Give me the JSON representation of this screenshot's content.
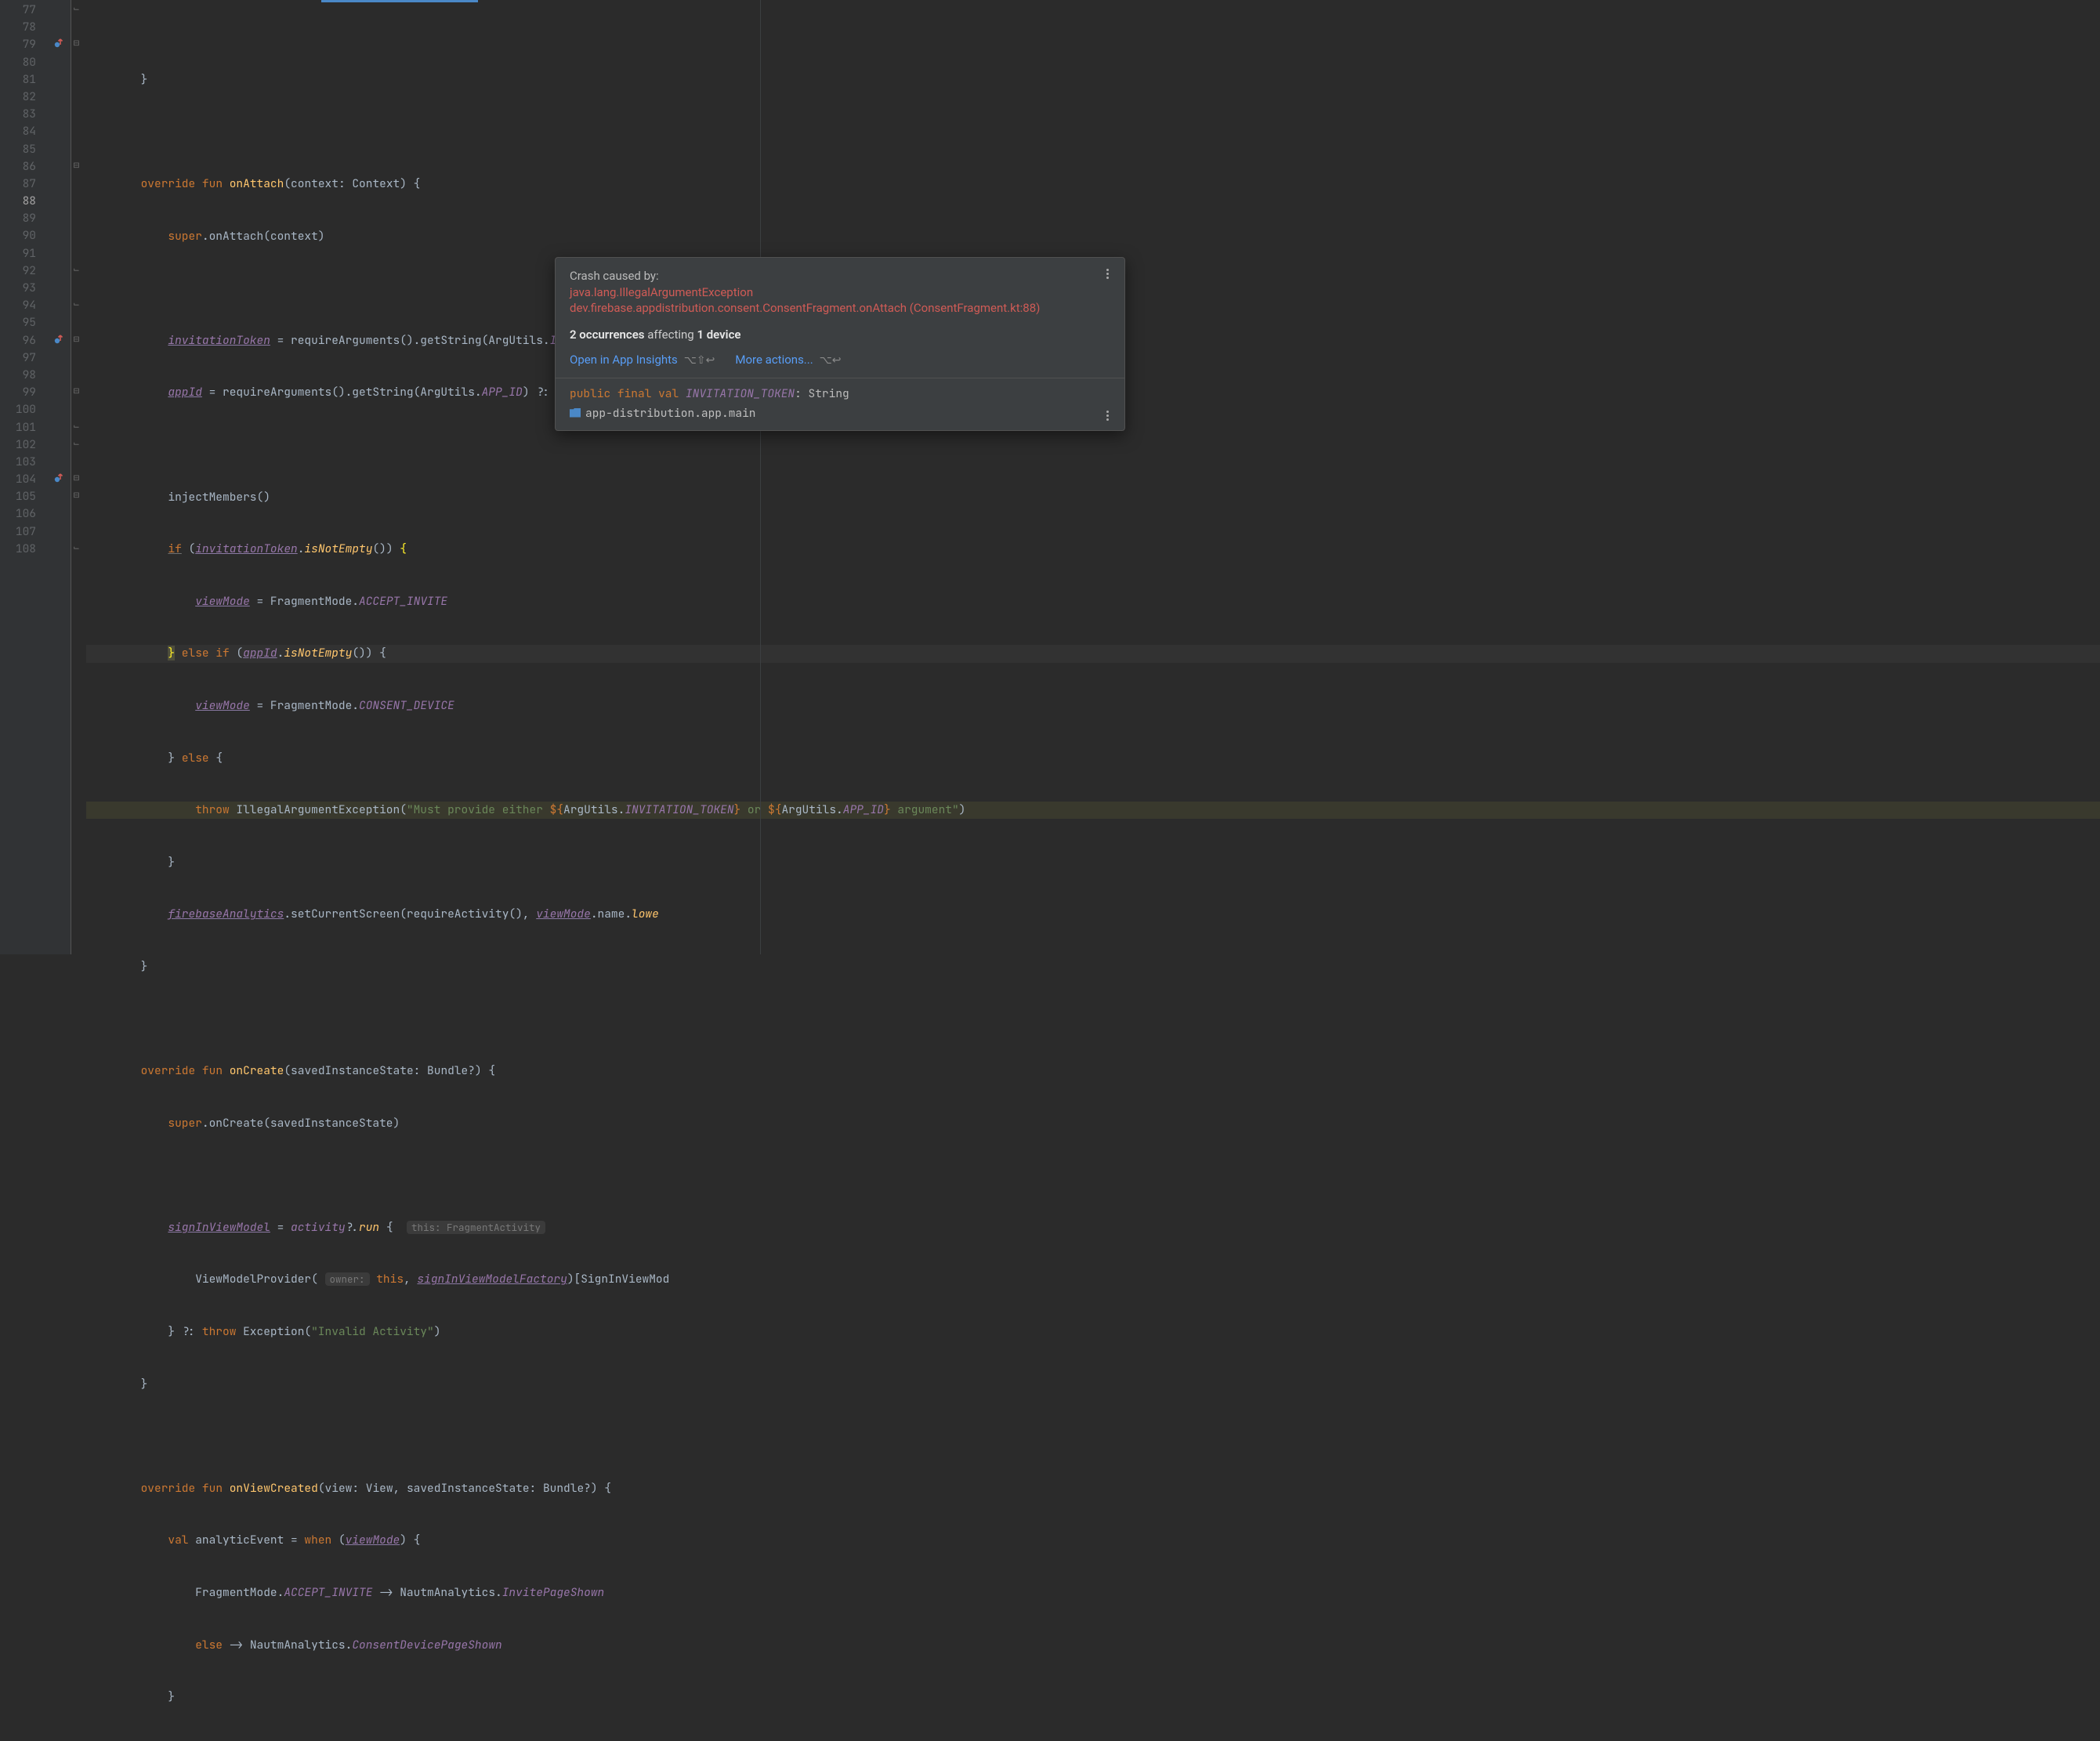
{
  "gutter": {
    "start": 77,
    "end": 108,
    "current": 88,
    "override_markers": [
      79,
      96,
      104
    ]
  },
  "fold_markers": {
    "minus_at": [
      79,
      86,
      96,
      99,
      104,
      105
    ],
    "end_at": [
      77,
      92,
      94,
      101,
      102,
      108
    ]
  },
  "code": {
    "l77": "        }",
    "l79_override": "override",
    "l79_fun": "fun",
    "l79_name": "onAttach",
    "l79_params": "(context: Context) {",
    "l80_super": "super",
    "l80_rest": ".onAttach(context)",
    "l82_field": "invitationToken",
    "l82_mid": " = requireArguments().getString(ArgUtils.",
    "l82_const": "INVITATION_TOKEN",
    "l82_tail": ") ?: ",
    "l82_str": "\"\"",
    "l83_field": "appId",
    "l83_mid": " = requireArguments().getString(ArgUtils.",
    "l83_const": "APP_ID",
    "l83_tail": ") ?: ",
    "l83_str": "\"\"",
    "l85": "            injectMembers()",
    "l86_if": "if",
    "l86_open": " (",
    "l86_tok": "invitationToken",
    "l86_dot": ".",
    "l86_fn": "isNotEmpty",
    "l86_close": "()) ",
    "l86_brace": "{",
    "l87_vm": "viewMode",
    "l87_eq": " = FragmentMode.",
    "l87_const": "ACCEPT_INVITE",
    "l88_close": "}",
    "l88_else": " else if ",
    "l88_open": "(",
    "l88_tok": "appId",
    "l88_dot": ".",
    "l88_fn": "isNotEmpty",
    "l88_cl2": "()) {",
    "l89_vm": "viewMode",
    "l89_eq": " = FragmentMode.",
    "l89_const": "CONSENT_DEVICE",
    "l90_close": "} ",
    "l90_else": "else",
    "l90_brace": " {",
    "l91_throw": "throw",
    "l91_cls": " IllegalArgumentException(",
    "l91_s1": "\"Must provide either ",
    "l91_d1": "${",
    "l91_a1": "ArgUtils.",
    "l91_c1": "INVITATION_TOKEN",
    "l91_d1e": "}",
    "l91_s2": " or ",
    "l91_d2": "${",
    "l91_a2": "ArgUtils.",
    "l91_c2": "APP_ID",
    "l91_d2e": "}",
    "l91_s3": " argument\"",
    "l91_end": ")",
    "l92": "            }",
    "l93_fa": "firebaseAnalytics",
    "l93_mid": ".setCurrentScreen(requireActivity(), ",
    "l93_vm": "viewMode",
    "l93_tail": ".name.",
    "l93_lowe": "lowe",
    "l94": "        }",
    "l96_override": "override",
    "l96_fun": "fun",
    "l96_name": "onCreate",
    "l96_params": "(savedInstanceState: Bundle?) {",
    "l97_super": "super",
    "l97_rest": ".onCreate(savedInstanceState)",
    "l99_field": "signInViewModel",
    "l99_eq": " = ",
    "l99_act": "activity",
    "l99_q": "?.",
    "l99_run": "run",
    "l99_brace": " {",
    "l99_hint": "this: FragmentActivity",
    "l100_pre": "                ViewModelProvider( ",
    "l100_hint": "owner:",
    "l100_this": " this",
    "l100_comma": ", ",
    "l100_fac": "signInViewModelFactory",
    "l100_tail": ")[SignInViewMod",
    "l101_close": "} ?: ",
    "l101_throw": "throw",
    "l101_rest": " Exception(",
    "l101_str": "\"Invalid Activity\"",
    "l101_end": ")",
    "l102": "        }",
    "l104_override": "override",
    "l104_fun": "fun",
    "l104_name": "onViewCreated",
    "l104_params": "(view: View, savedInstanceState: Bundle?) {",
    "l105_val": "val",
    "l105_rest": " analyticEvent = ",
    "l105_when": "when",
    "l105_open": " (",
    "l105_vm": "viewMode",
    "l105_close": ") {",
    "l106_pre": "                FragmentMode.",
    "l106_const": "ACCEPT_INVITE",
    "l106_arrow": " -> NautmAnalytics.",
    "l106_v": "InvitePageShown",
    "l107_else": "else",
    "l107_arrow": " -> NautmAnalytics.",
    "l107_v": "ConsentDevicePageShown",
    "l108": "            }"
  },
  "popup": {
    "title": "Crash caused by:",
    "exception": "java.lang.IllegalArgumentException",
    "location": "dev.firebase.appdistribution.consent.ConsentFragment.onAttach (ConsentFragment.kt:88)",
    "occ_count": "2 occurrences",
    "occ_mid": " affecting ",
    "occ_dev": "1 device",
    "link_open": "Open in App Insights",
    "sc_open": "⌥⇧↩",
    "link_more": "More actions...",
    "sc_more": "⌥↩",
    "decl_kw1": "public",
    "decl_kw2": "final",
    "decl_kw3": "val",
    "decl_name": "INVITATION_TOKEN",
    "decl_type": ": String",
    "module": "app-distribution.app.main"
  }
}
